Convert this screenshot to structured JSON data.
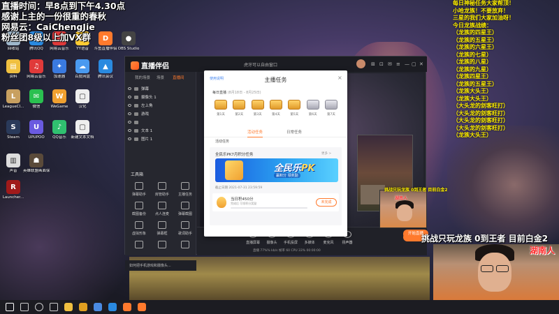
{
  "overlay": {
    "lines": [
      "直播时间：早8点到下午4.30点",
      "感谢上主的一份很重的春秋",
      "网易云：CaiChengJie",
      "粉丝团8级以上加VX群"
    ]
  },
  "yellow_list": [
    "每日神秘任务大家帮顶！",
    "小哈龙族！不要放弃！",
    "三星的我们大家加油呀！",
    "今日龙族战绩：",
    "（龙族的四星王）",
    "（龙族的五星王）",
    "（龙族的六星王）",
    "（龙族的七星）",
    "（龙族的八星）",
    "（龙族的九星）",
    "（龙族四星王）",
    "（龙族的五星王）",
    "（龙族大头王）",
    "（龙族大头王）",
    "（大头龙的剑客旺打）",
    "（大头龙的剑客旺打）",
    "（大头龙的剑客旺打）",
    "（大头龙的剑客旺打）",
    "（龙族大头王）"
  ],
  "desktop_icons": [
    {
      "label": "回收站",
      "color": "#9fb8cc",
      "glyph": "♻"
    },
    {
      "label": "腾讯QQ",
      "color": "#2a8ae0",
      "glyph": "Q"
    },
    {
      "label": "网易云音乐",
      "color": "#e03a3a",
      "glyph": "♫"
    },
    {
      "label": "YY语音",
      "color": "#ffcc33",
      "glyph": "Y"
    },
    {
      "label": "斗鱼直播伴侣",
      "color": "#ff7a2d",
      "glyph": "D"
    },
    {
      "label": "OBS Studio",
      "color": "#444",
      "glyph": "●"
    },
    {
      "label": "资料",
      "color": "#f0c040",
      "glyph": "▤"
    },
    {
      "label": "网易云音乐",
      "color": "#e03a3a",
      "glyph": "♫"
    },
    {
      "label": "加速器",
      "color": "#3a7ae0",
      "glyph": "✦"
    },
    {
      "label": "百度网盘",
      "color": "#4a9af0",
      "glyph": "☁"
    },
    {
      "label": "腾讯会议",
      "color": "#2a8ae0",
      "glyph": "▲"
    },
    {
      "label": "LeagueCl...",
      "color": "#c8a060",
      "glyph": "L"
    },
    {
      "label": "微信",
      "color": "#2ac050",
      "glyph": "✉"
    },
    {
      "label": "WeGame",
      "color": "#f0a030",
      "glyph": "W"
    },
    {
      "label": "汉化",
      "color": "#eee",
      "glyph": "▢"
    },
    {
      "label": "Steam",
      "color": "#2a3a5a",
      "glyph": "S"
    },
    {
      "label": "UPUPOO",
      "color": "#6a5ae0",
      "glyph": "U"
    },
    {
      "label": "QQ音乐",
      "color": "#30c070",
      "glyph": "♪"
    },
    {
      "label": "新建文本文档",
      "color": "#eee",
      "glyph": "▢"
    },
    {
      "label": "声音",
      "color": "#ddd",
      "glyph": "▥"
    },
    {
      "label": "英雄联盟画面保护程序",
      "color": "#5a4a3a",
      "glyph": "☗"
    },
    {
      "label": "Launcher...",
      "color": "#a01a1a",
      "glyph": "R"
    }
  ],
  "app": {
    "name": "直播伴侣",
    "title_center": "虎牙可以自由窗口",
    "left_tabs": [
      "我的场景",
      "场景",
      "直播间"
    ],
    "sources": [
      "弹幕",
      "摄像头 1",
      "左上角",
      "游戏",
      "",
      "文本 1",
      "图片 1"
    ],
    "tools_header": "工具箱",
    "tools": [
      "弹幕助手",
      "房管助手",
      "主播任务",
      "截图备份",
      "点人连麦",
      "弹幕截图",
      "虚拟形象",
      "弹幕框",
      "歌词助手",
      "",
      "",
      ""
    ],
    "ask_bar": "如何把手机游戏和摄像头...",
    "bottom_items": [
      "直播屏幕",
      "摄像头",
      "手机投屏",
      "多媒体",
      "麦克风",
      "扬声器"
    ],
    "start_live": "开始直播",
    "status": "直播 77%% kb/s  帧率 60  CPU 33%  00:00:00"
  },
  "dialog": {
    "sub": "使用说明",
    "title": "主播任务",
    "close": "×",
    "week_head": "每日直播",
    "week_range": "(8月18日 - 8月25日)",
    "chests": [
      {
        "label": "第1天",
        "kind": "gold"
      },
      {
        "label": "第2天",
        "kind": "gold"
      },
      {
        "label": "第3天",
        "kind": "gold"
      },
      {
        "label": "第4天",
        "kind": "gold"
      },
      {
        "label": "第5天",
        "kind": "gold"
      },
      {
        "label": "第6天",
        "kind": "silver"
      },
      {
        "label": "第7天",
        "kind": "silver"
      }
    ],
    "tabs": [
      "活动任务",
      "日常任务"
    ],
    "activity_head": "活动任务",
    "card": {
      "title": "全民乐PK7月积分任务",
      "more": "更多 >",
      "banner_title_a": "全民乐",
      "banner_title_b": "PK",
      "banner_sub": "赢积分 领奖励",
      "time": "截止日期 2021-07-31 23:59:59",
      "task_name": "当日积450分",
      "task_desc": "完成后 可领积分奖励",
      "task_progress": 0,
      "task_btn": "未完成"
    }
  },
  "cam": {
    "small_label": "挑战只玩龙族 0到王者 目前白金2",
    "small_hunan": "湖南人",
    "orange_btn": "开始直播",
    "big_challenge": "挑战只玩龙族 0到王者 目前白金2",
    "big_hunan": "湖南人"
  },
  "taskbar_icons": [
    "start",
    "search",
    "cortana",
    "taskview",
    "explorer",
    "chrome",
    "store",
    "qq",
    "live",
    "obs"
  ]
}
